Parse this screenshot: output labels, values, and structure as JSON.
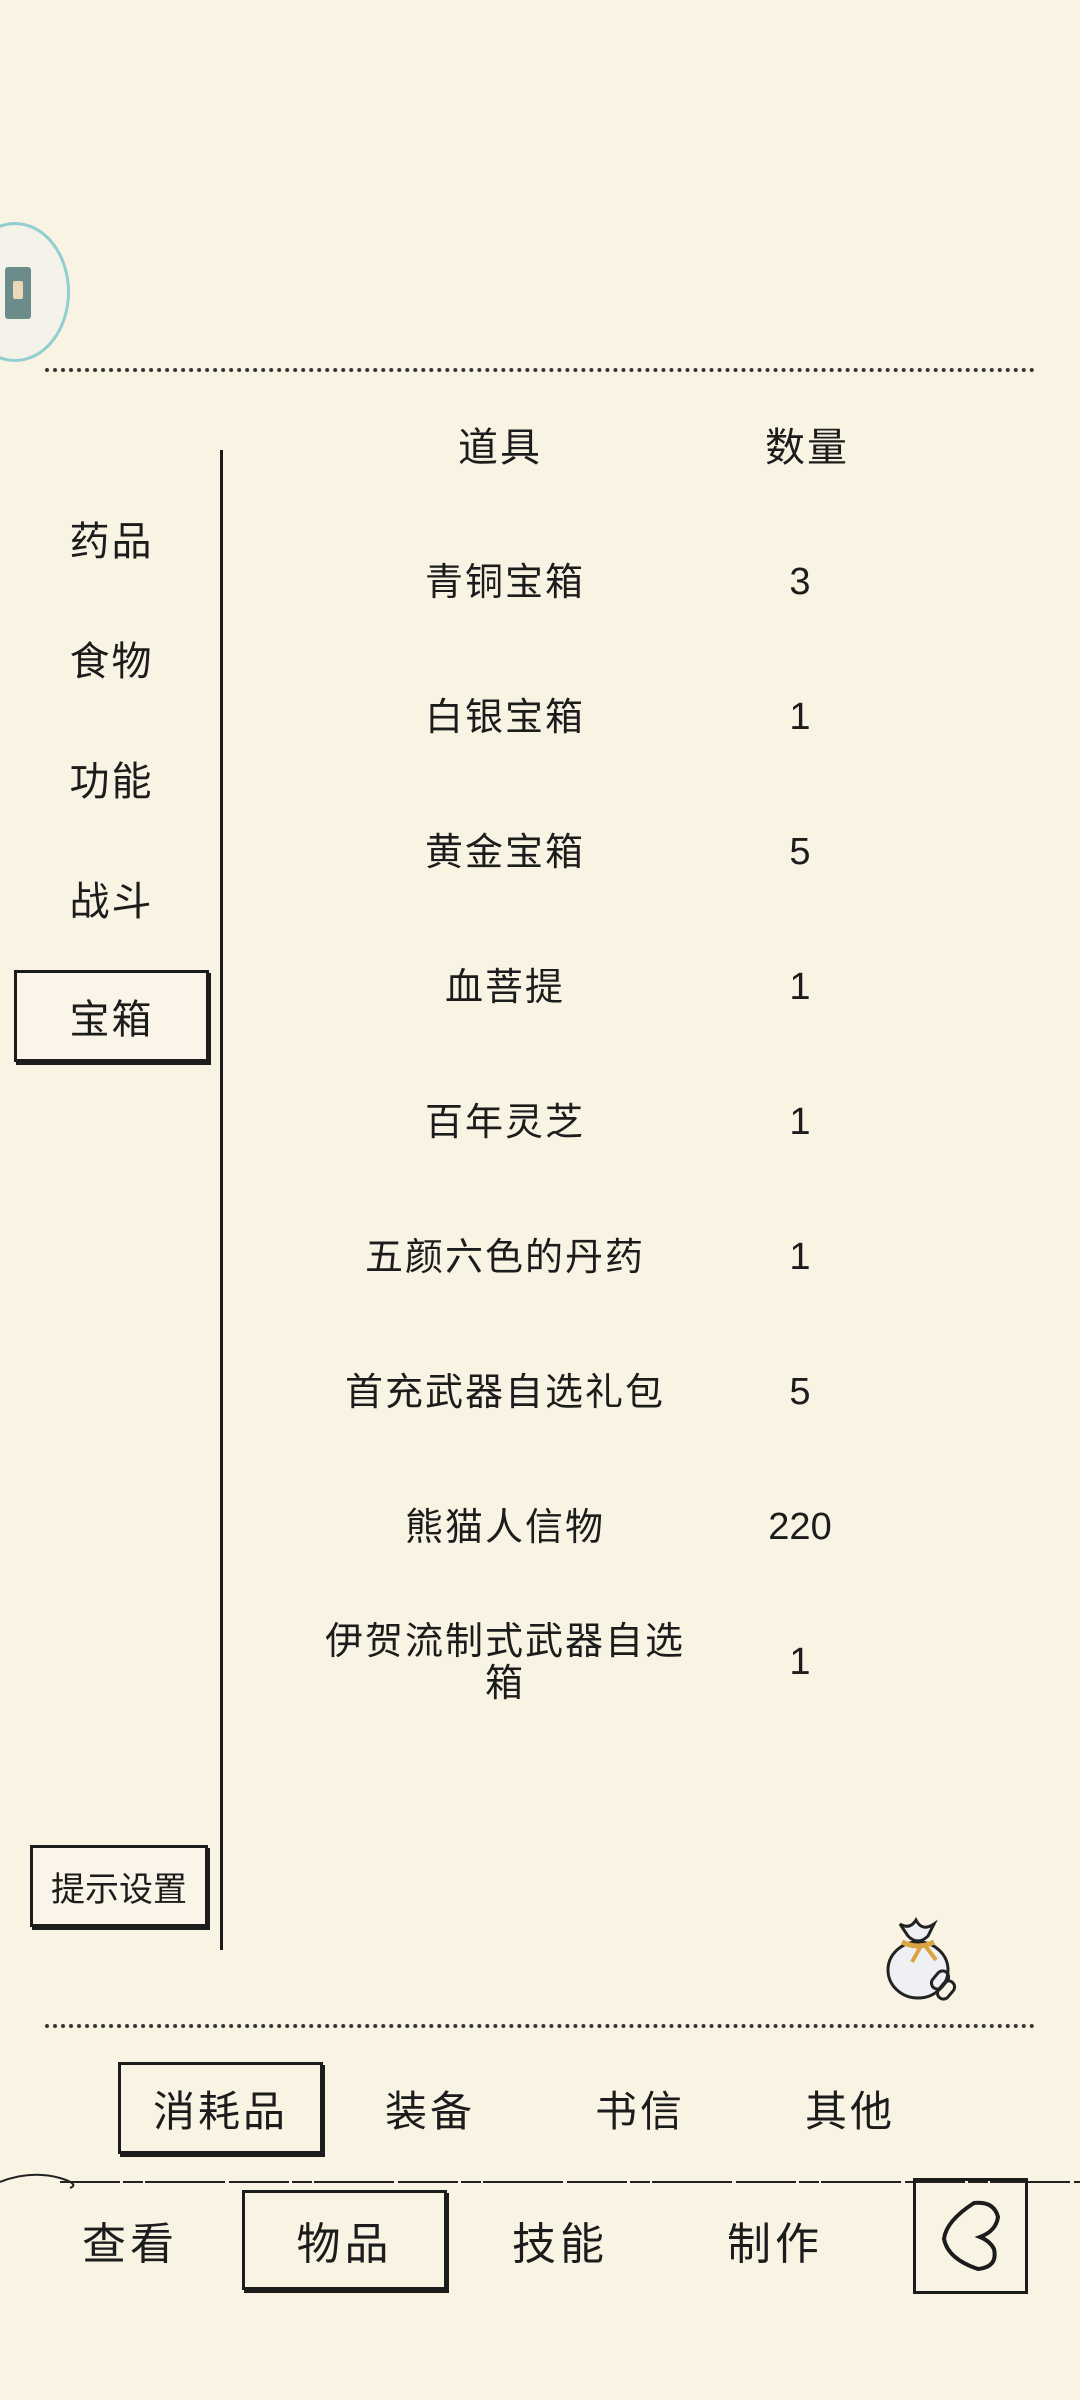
{
  "icons": {
    "floating": "app-logo-icon",
    "bag": "item-bag-icon",
    "back": "back-arrow-icon"
  },
  "categories": [
    {
      "label": "药品",
      "active": false
    },
    {
      "label": "食物",
      "active": false
    },
    {
      "label": "功能",
      "active": false
    },
    {
      "label": "战斗",
      "active": false
    },
    {
      "label": "宝箱",
      "active": true
    }
  ],
  "table": {
    "headers": {
      "item": "道具",
      "quantity": "数量"
    },
    "rows": [
      {
        "name": "青铜宝箱",
        "qty": "3"
      },
      {
        "name": "白银宝箱",
        "qty": "1"
      },
      {
        "name": "黄金宝箱",
        "qty": "5"
      },
      {
        "name": "血菩提",
        "qty": "1"
      },
      {
        "name": "百年灵芝",
        "qty": "1"
      },
      {
        "name": "五颜六色的丹药",
        "qty": "1"
      },
      {
        "name": "首充武器自选礼包",
        "qty": "5"
      },
      {
        "name": "熊猫人信物",
        "qty": "220"
      },
      {
        "name": "伊贺流制式武器自选箱",
        "qty": "1"
      }
    ]
  },
  "hint_settings": "提示设置",
  "subtabs": [
    {
      "label": "消耗品",
      "active": true
    },
    {
      "label": "装备",
      "active": false
    },
    {
      "label": "书信",
      "active": false
    },
    {
      "label": "其他",
      "active": false
    }
  ],
  "nav": [
    {
      "label": "查看",
      "active": false
    },
    {
      "label": "物品",
      "active": true
    },
    {
      "label": "技能",
      "active": false
    },
    {
      "label": "制作",
      "active": false
    }
  ]
}
